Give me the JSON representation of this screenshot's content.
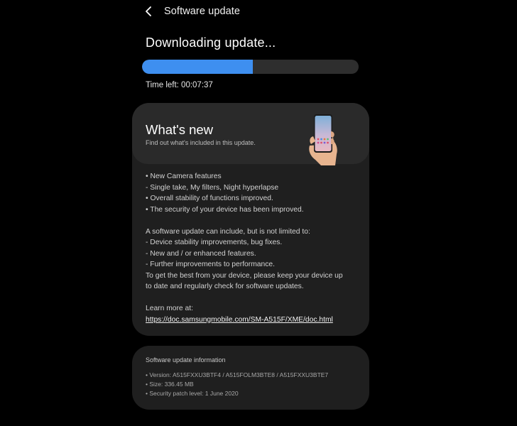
{
  "app_bar": {
    "back_icon": "chevron-left-icon",
    "title": "Software update"
  },
  "download": {
    "status": "Downloading update...",
    "progress_percent": 51,
    "progress_color": "#3e8ff0",
    "time_left": "Time left: 00:07:37"
  },
  "whats_new": {
    "title": "What's new",
    "subtitle": "Find out what's included in this update.",
    "illustration": "phone-in-hand-illustration",
    "lines": [
      "• New Camera features",
      " - Single take, My filters, Night hyperlapse",
      "• Overall stability of functions improved.",
      "• The security of your device has been improved.",
      "",
      "A software update can include, but is not limited to:",
      " - Device stability improvements, bug fixes.",
      " - New and / or enhanced features.",
      " - Further improvements to performance.",
      "To get the best from your device, please keep your device up",
      "to date and regularly check for software updates.",
      "",
      "Learn more at:"
    ],
    "link": "https://doc.samsungmobile.com/SM-A515F/XME/doc.html"
  },
  "info": {
    "title": "Software update information",
    "version": "• Version: A515FXXU3BTF4 / A515FOLM3BTE8 / A515FXXU3BTE7",
    "size": "• Size: 336.45 MB",
    "security_patch": "• Security patch level: 1 June 2020"
  }
}
